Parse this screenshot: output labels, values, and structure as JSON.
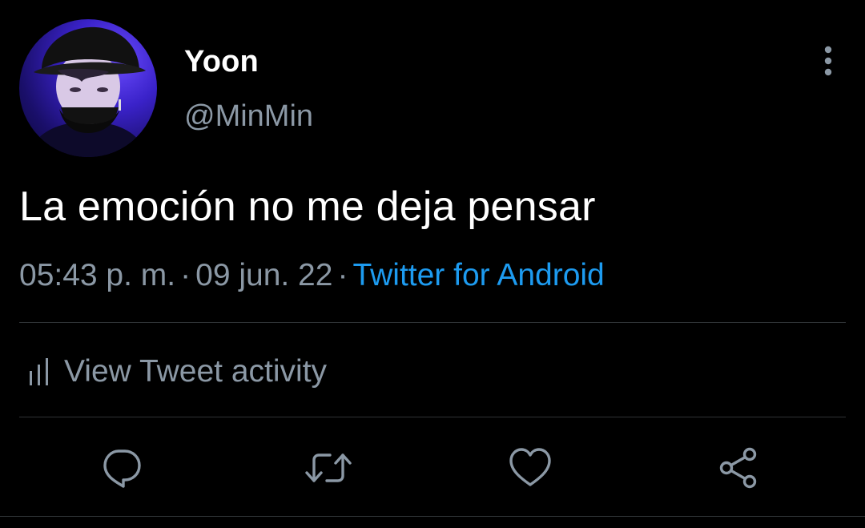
{
  "user": {
    "display_name": "Yoon",
    "handle": "@MinMin"
  },
  "tweet": {
    "text": "La emoción no me deja pensar",
    "time": "05:43 p. m.",
    "separator": "·",
    "date": "09 jun. 22",
    "source": "Twitter for Android"
  },
  "activity": {
    "label": "View Tweet activity"
  },
  "icons": {
    "more": "more-vertical-icon",
    "activity": "bar-chart-icon",
    "reply": "reply-icon",
    "retweet": "retweet-icon",
    "like": "heart-icon",
    "share": "share-icon"
  },
  "colors": {
    "background": "#000000",
    "primary_text": "#ffffff",
    "secondary_text": "#8b98a5",
    "link": "#1d9bf0",
    "divider": "#2f3336"
  }
}
